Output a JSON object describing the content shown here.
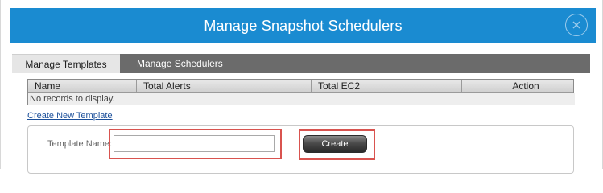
{
  "dialog": {
    "title": "Manage Snapshot Schedulers",
    "close_icon": "close-icon"
  },
  "tabs": [
    {
      "label": "Manage Templates",
      "active": true
    },
    {
      "label": "Manage Schedulers",
      "active": false
    }
  ],
  "table": {
    "columns": [
      "Name",
      "Total Alerts",
      "Total EC2",
      "Action"
    ],
    "empty_message": "No records to display."
  },
  "create_link": "Create New Template",
  "form": {
    "template_name_label": "Template Name:",
    "template_name_value": "",
    "create_button": "Create"
  },
  "colors": {
    "title_bar": "#1a8bd1",
    "tab_bar": "#6b6b6b",
    "highlight": "#d9534f",
    "link": "#1b4f9a"
  }
}
